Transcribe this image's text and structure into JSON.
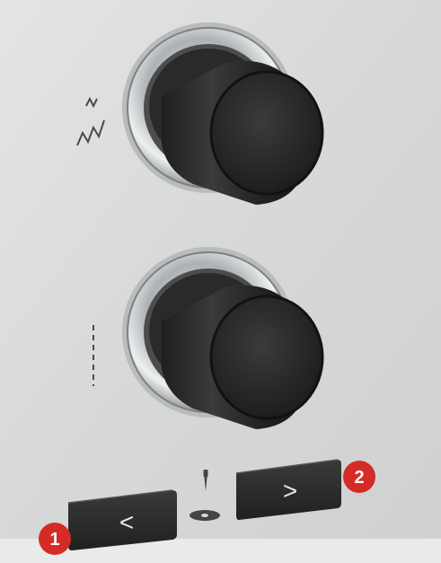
{
  "photo": {
    "panel_color": "#d8d9d9",
    "knob_color": "#2a2a2a",
    "chrome_color": "#c9cbcc",
    "button_color": "#2b2b2b",
    "badge_color": "#d42b26",
    "icon_color": "#4a4a4a"
  },
  "controls": {
    "stitch_width_icon": "zigzag-icon",
    "stitch_length_icon": "dashed-line-icon",
    "needle_position_icon": "needle-position-icon",
    "left_button": {
      "glyph": "<",
      "badge": "1"
    },
    "right_button": {
      "glyph": ">",
      "badge": "2"
    }
  }
}
